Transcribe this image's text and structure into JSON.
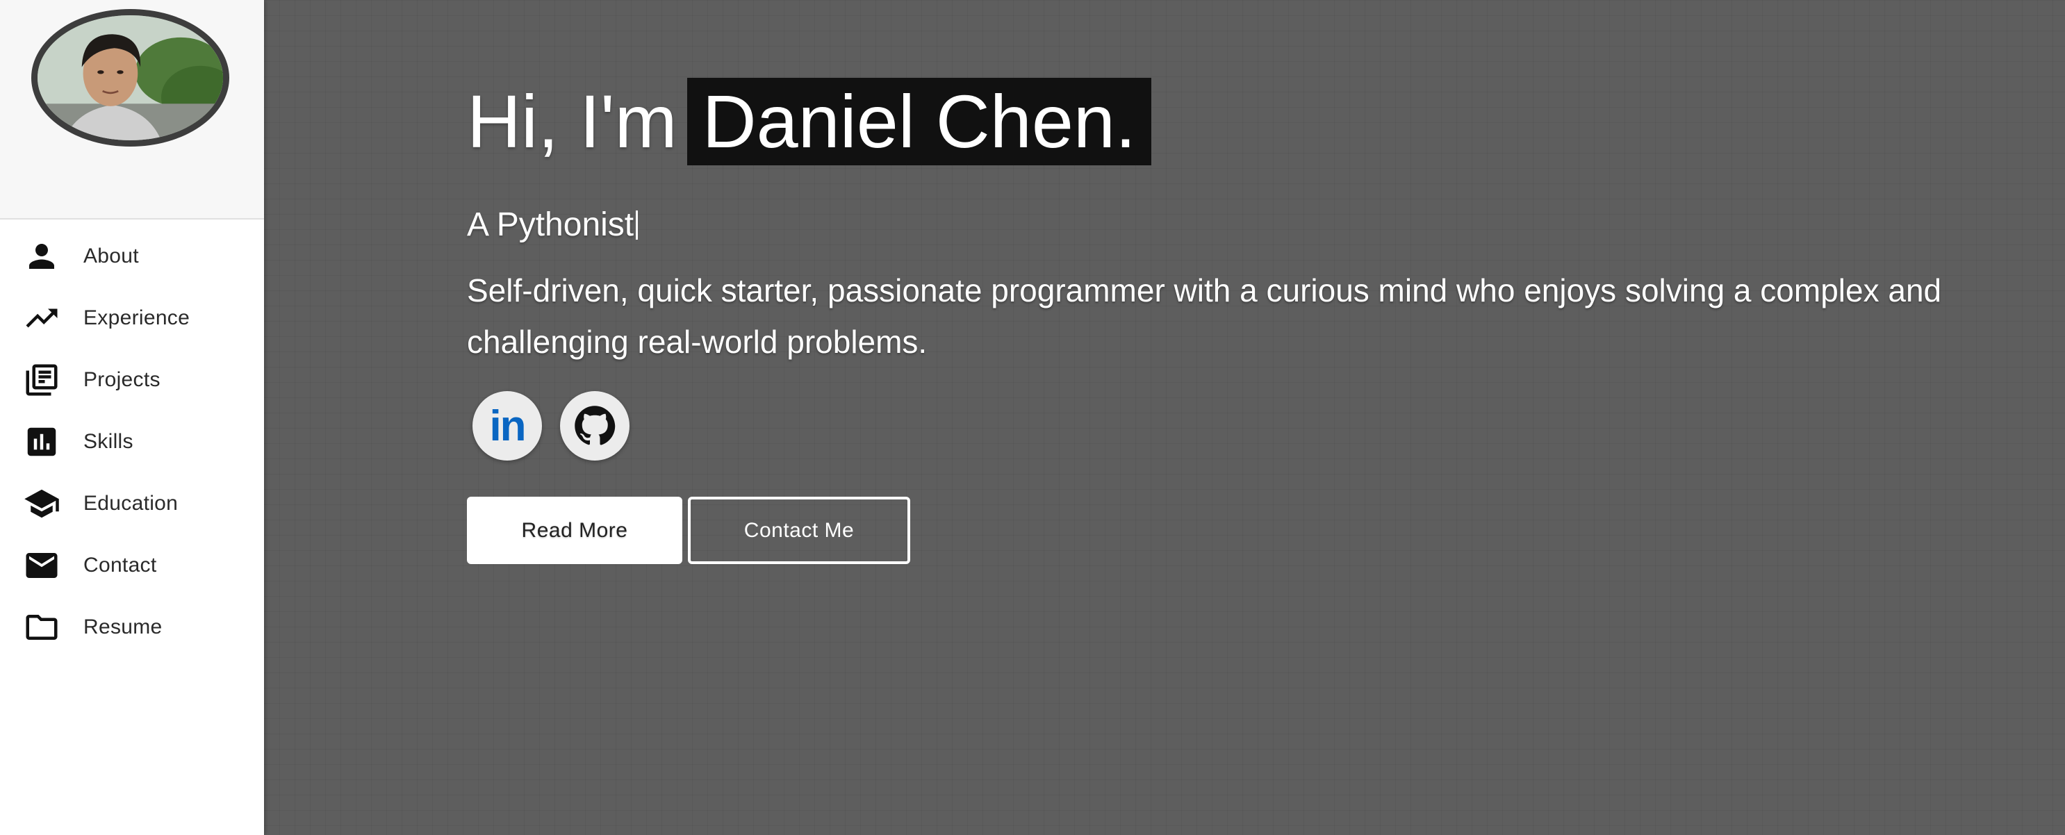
{
  "sidebar": {
    "avatar_alt": "",
    "items": [
      {
        "label": "About",
        "icon": "person-icon"
      },
      {
        "label": "Experience",
        "icon": "trending-up-icon"
      },
      {
        "label": "Projects",
        "icon": "library-books-icon"
      },
      {
        "label": "Skills",
        "icon": "bar-chart-icon"
      },
      {
        "label": "Education",
        "icon": "school-icon"
      },
      {
        "label": "Contact",
        "icon": "mail-icon"
      },
      {
        "label": "Resume",
        "icon": "folder-icon"
      }
    ]
  },
  "hero": {
    "greeting": "Hi, I'm",
    "name": "Daniel Chen.",
    "tagline": "A Pythonist",
    "summary": "Self-driven, quick starter, passionate programmer with a curious mind who enjoys solving a complex and challenging real-world problems.",
    "socials": [
      {
        "icon": "linkedin-icon",
        "text": "in"
      },
      {
        "icon": "github-icon"
      }
    ],
    "primary_button": "Read More",
    "secondary_button": "Contact Me"
  },
  "colors": {
    "hero_bg": "#5e5e5e",
    "name_highlight": "#111111",
    "linkedin_blue": "#0a66c2",
    "sidebar_bg": "#ffffff"
  }
}
